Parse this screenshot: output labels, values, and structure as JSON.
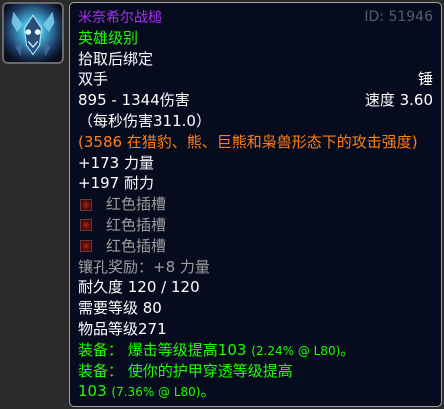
{
  "item": {
    "name": "米奈希尔战槌",
    "id_label": "ID: 51946",
    "quality": "英雄级别",
    "binding": "拾取后绑定",
    "slot": "双手",
    "weapon_type": "锤",
    "damage": "895 - 1344伤害",
    "speed": "速度 3.60",
    "dps": "（每秒伤害311.0）",
    "feral_ap": "(3586 在猎豹、熊、巨熊和枭兽形态下的攻击强度)",
    "stats": [
      "+173 力量",
      "+197 耐力"
    ],
    "sockets": [
      "红色插槽",
      "红色插槽",
      "红色插槽"
    ],
    "socket_bonus": "镶孔奖励：+8 力量",
    "durability": "耐久度 120 / 120",
    "required_level": "需要等级 80",
    "item_level": "物品等级271",
    "equip1": {
      "prefix": "装备：",
      "text": "爆击等级提高103",
      "detail": "(2.24% @ L80)",
      "suffix": "。"
    },
    "equip2": {
      "prefix": "装备：",
      "text": "使你的护甲穿透等级提高",
      "text2": "103",
      "detail": "(7.36% @ L80)",
      "suffix": "。"
    }
  },
  "colors": {
    "epic": "#a335ee",
    "uncommon": "#1eff00",
    "feral": "#ff7f17",
    "disabled": "#9d9d9d",
    "socket_red": "#b0201c"
  },
  "icons": {
    "item_icon": "mace-head-icon",
    "socket_icon": "red-socket-icon"
  }
}
